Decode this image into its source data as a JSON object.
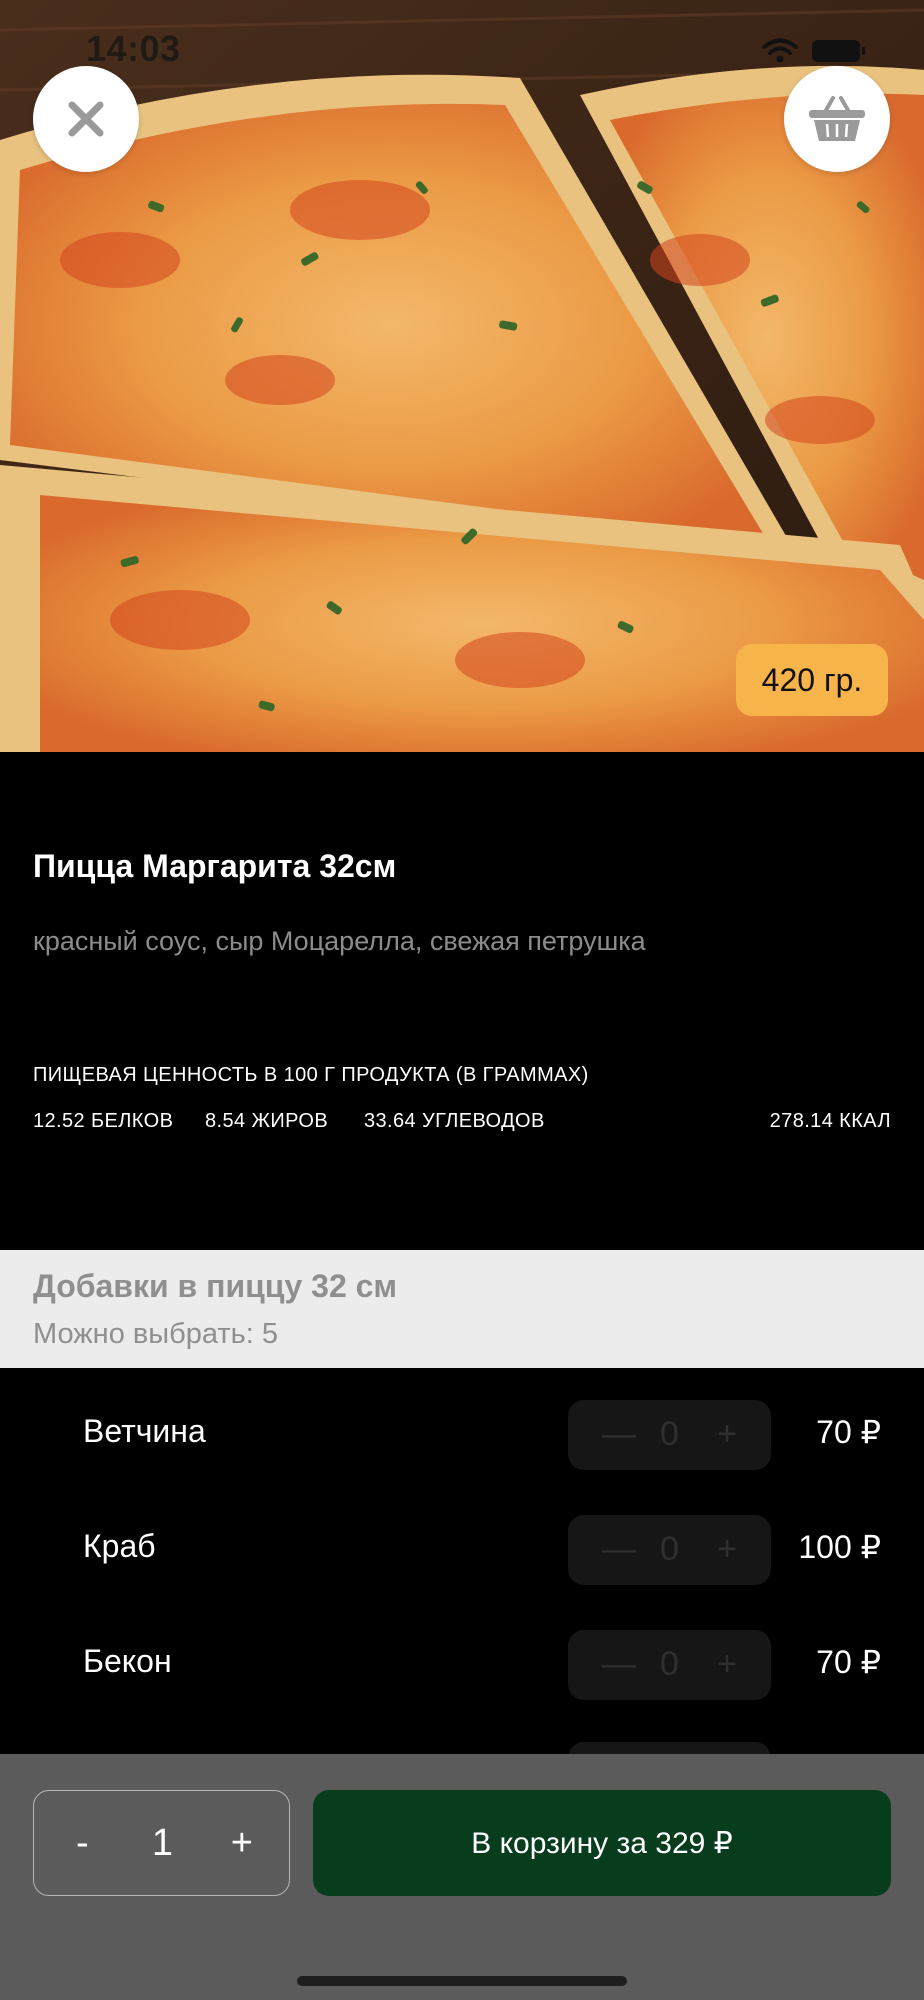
{
  "status_bar": {
    "time": "14:03"
  },
  "hero": {
    "weight_badge": "420 гр.",
    "close_icon": "close-icon",
    "basket_icon": "basket-icon"
  },
  "product": {
    "title": "Пицца Маргарита 32см",
    "description": "красный соус, сыр Моцарелла, свежая петрушка"
  },
  "nutrition": {
    "heading": "ПИЩЕВАЯ ЦЕННОСТЬ В 100 Г ПРОДУКТА (В ГРАММАХ)",
    "protein": "12.52 БЕЛКОВ",
    "fat": "8.54 ЖИРОВ",
    "carbs": "33.64 УГЛЕВОДОВ",
    "kcal": "278.14 ККАЛ"
  },
  "additions": {
    "title": "Добавки в пиццу 32 см",
    "subtitle": "Можно выбрать: 5",
    "items": [
      {
        "name": "Ветчина",
        "count": "0",
        "price": "70 ₽",
        "minus": "—",
        "plus": "+"
      },
      {
        "name": "Краб",
        "count": "0",
        "price": "100 ₽",
        "minus": "—",
        "plus": "+"
      },
      {
        "name": "Бекон",
        "count": "0",
        "price": "70 ₽",
        "minus": "—",
        "plus": "+"
      }
    ]
  },
  "bottom": {
    "qty_minus": "-",
    "qty_value": "1",
    "qty_plus": "+",
    "add_to_cart": "В корзину за 329 ₽"
  },
  "colors": {
    "accent_button": "#073d1c",
    "weight_badge": "#f7b44a",
    "additions_header_bg": "#ececec"
  }
}
